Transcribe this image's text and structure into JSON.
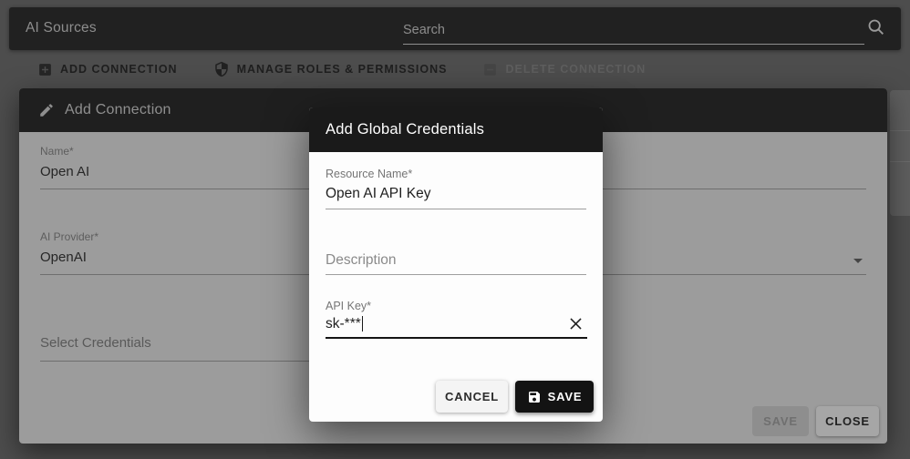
{
  "app_bar": {
    "title": "AI Sources",
    "search_placeholder": "Search"
  },
  "toolbar": {
    "add_connection": "ADD CONNECTION",
    "manage_roles": "MANAGE ROLES & PERMISSIONS",
    "delete_connection": "DELETE CONNECTION"
  },
  "dialog": {
    "title": "Add Connection",
    "fields": {
      "name": {
        "label": "Name*",
        "value": "Open AI"
      },
      "provider": {
        "label": "AI Provider*",
        "value": "OpenAI"
      },
      "credentials": {
        "placeholder": "Select Credentials"
      }
    },
    "buttons": {
      "save": "SAVE",
      "close": "CLOSE"
    }
  },
  "modal": {
    "title": "Add Global Credentials",
    "fields": {
      "resource_name": {
        "label": "Resource Name*",
        "value": "Open AI API Key"
      },
      "description": {
        "placeholder": "Description"
      },
      "api_key": {
        "label": "API Key*",
        "value": "sk-***"
      }
    },
    "buttons": {
      "cancel": "CANCEL",
      "save": "SAVE"
    }
  },
  "icons": {
    "search": "magnifier",
    "add": "plus-box",
    "manage": "shield",
    "delete": "minus-box",
    "edit": "pencil",
    "clear": "x-cross",
    "save": "floppy-disk"
  },
  "colors": {
    "app_bar": "#212121",
    "modal_header": "#1a1a1a",
    "dimmed_surface": "#9c9c9c",
    "page_background": "#4d4d4d",
    "modal_surface": "#fdfdfd"
  }
}
